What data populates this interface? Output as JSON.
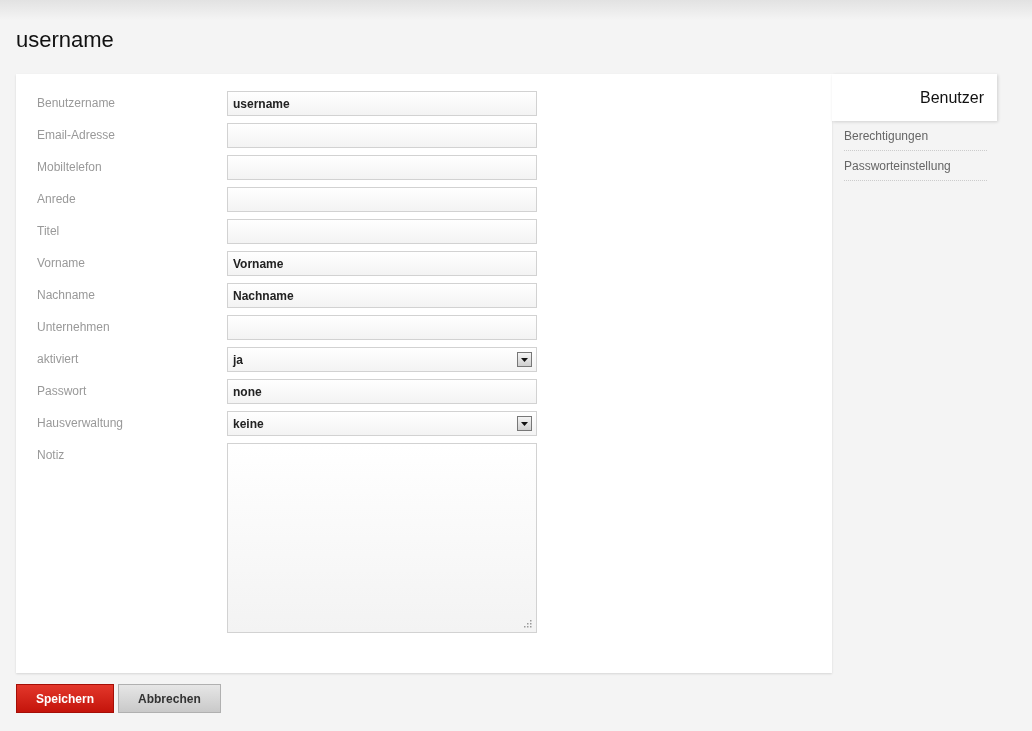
{
  "page": {
    "title": "username"
  },
  "fields": [
    {
      "kind": "text",
      "label": "Benutzername",
      "value": "username"
    },
    {
      "kind": "text",
      "label": "Email-Adresse"
    },
    {
      "kind": "text",
      "label": "Mobiltelefon"
    },
    {
      "kind": "text",
      "label": "Anrede"
    },
    {
      "kind": "text",
      "label": "Titel"
    },
    {
      "kind": "text",
      "label": "Vorname",
      "value": "Vorname"
    },
    {
      "kind": "text",
      "label": "Nachname",
      "value": "Nachname"
    },
    {
      "kind": "text",
      "label": "Unternehmen"
    },
    {
      "kind": "select",
      "label": "aktiviert",
      "value": "ja"
    },
    {
      "kind": "text",
      "label": "Passwort",
      "value": "none"
    },
    {
      "kind": "select",
      "label": "Hausverwaltung",
      "value": "keine"
    },
    {
      "kind": "textarea",
      "label": "Notiz"
    }
  ],
  "tabs": [
    {
      "label": "Benutzer",
      "selected": true
    },
    {
      "label": "Berechtigungen",
      "selected": false
    },
    {
      "label": "Passworteinstellung",
      "selected": false
    }
  ],
  "buttons": [
    {
      "kind": "primary",
      "label": "Speichern"
    },
    {
      "kind": "secondary",
      "label": "Abbrechen"
    }
  ]
}
